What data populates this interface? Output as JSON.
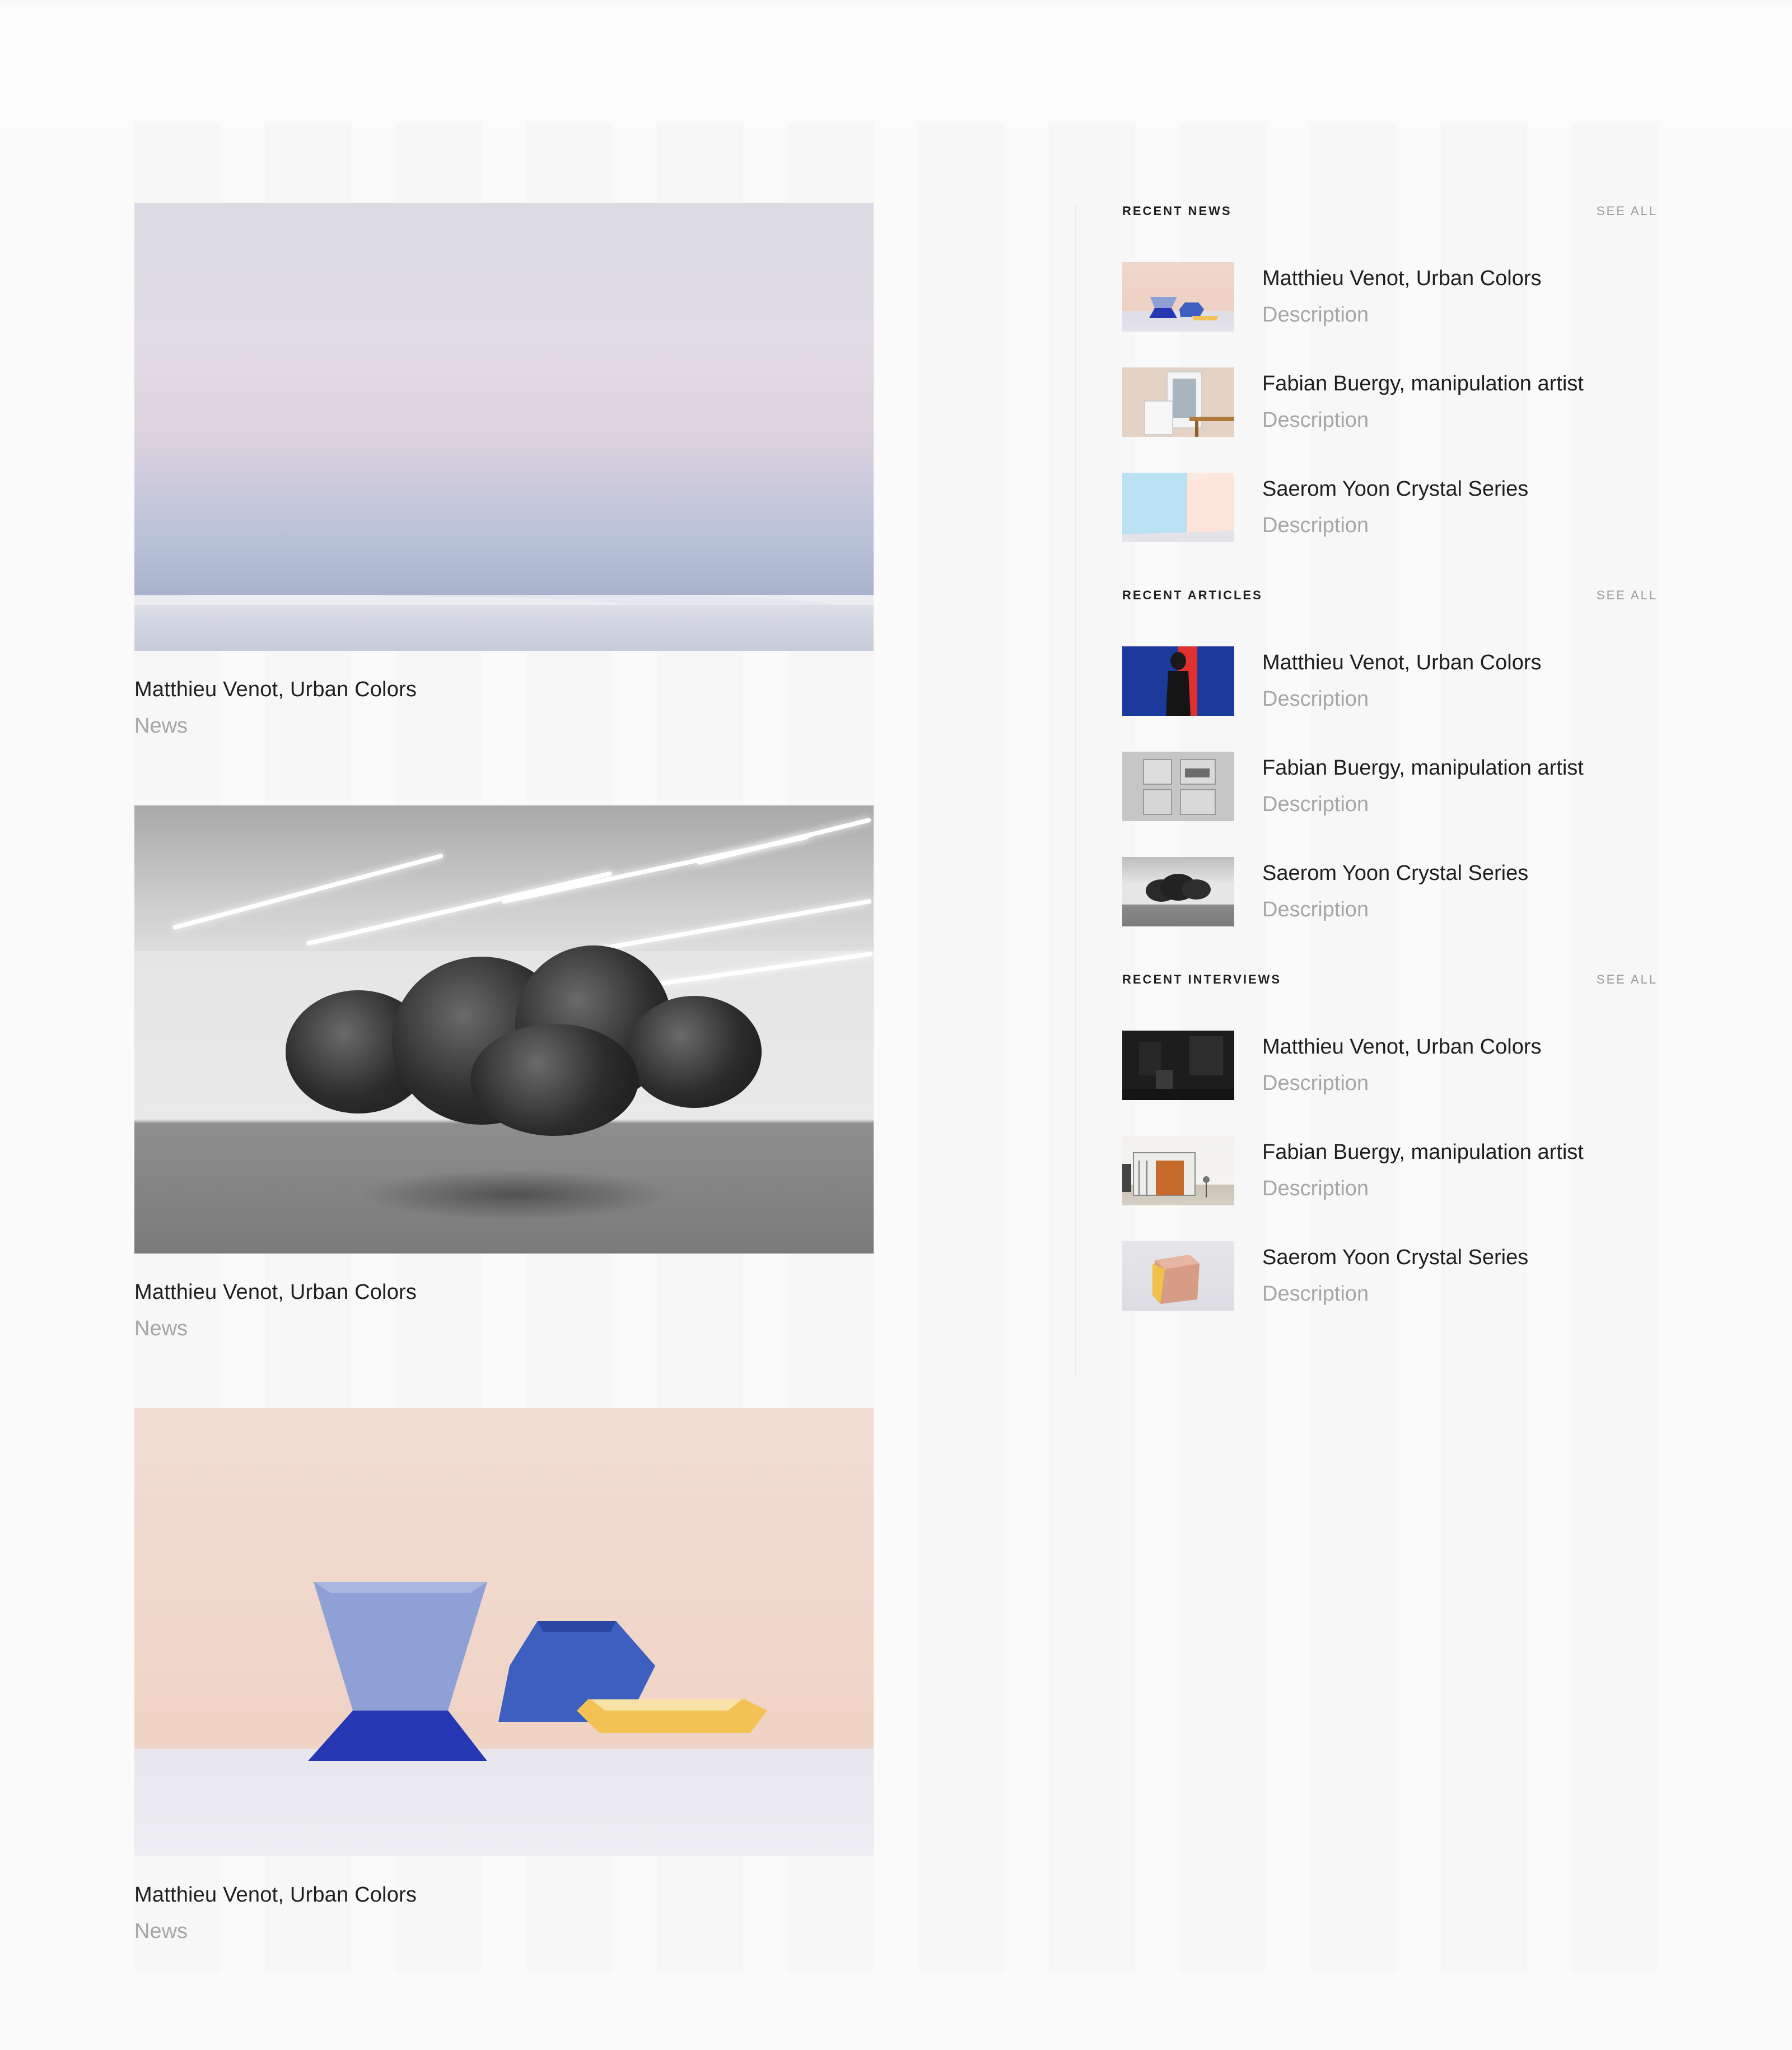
{
  "main_feed": {
    "cards": [
      {
        "title": "Matthieu Venot, Urban Colors",
        "category": "News",
        "image": "desert-sky-photo"
      },
      {
        "title": "Matthieu Venot, Urban Colors",
        "category": "News",
        "image": "gallery-cloud-photo"
      },
      {
        "title": "Matthieu Venot, Urban Colors",
        "category": "News",
        "image": "ceramics-photo"
      }
    ]
  },
  "sidebar": {
    "sections": [
      {
        "title": "RECENT NEWS",
        "see_all": "SEE ALL",
        "items": [
          {
            "title": "Matthieu Venot, Urban Colors",
            "description": "Description",
            "thumb": "ceramics-thumb"
          },
          {
            "title": "Fabian Buergy, manipulation artist",
            "description": "Description",
            "thumb": "frames-thumb"
          },
          {
            "title": "Saerom Yoon Crystal Series",
            "description": "Description",
            "thumb": "crystal-thumb"
          }
        ]
      },
      {
        "title": "RECENT ARTICLES",
        "see_all": "SEE ALL",
        "items": [
          {
            "title": "Matthieu Venot, Urban Colors",
            "description": "Description",
            "thumb": "red-blue-thumb"
          },
          {
            "title": "Fabian Buergy, manipulation artist",
            "description": "Description",
            "thumb": "grey-frames-thumb"
          },
          {
            "title": "Saerom Yoon Crystal Series",
            "description": "Description",
            "thumb": "cloud-thumb"
          }
        ]
      },
      {
        "title": "RECENT INTERVIEWS",
        "see_all": "SEE ALL",
        "items": [
          {
            "title": "Matthieu Venot, Urban Colors",
            "description": "Description",
            "thumb": "dark-studio-thumb"
          },
          {
            "title": "Fabian Buergy, manipulation artist",
            "description": "Description",
            "thumb": "facade-thumb"
          },
          {
            "title": "Saerom Yoon Crystal Series",
            "description": "Description",
            "thumb": "wood-box-thumb"
          }
        ]
      }
    ]
  }
}
